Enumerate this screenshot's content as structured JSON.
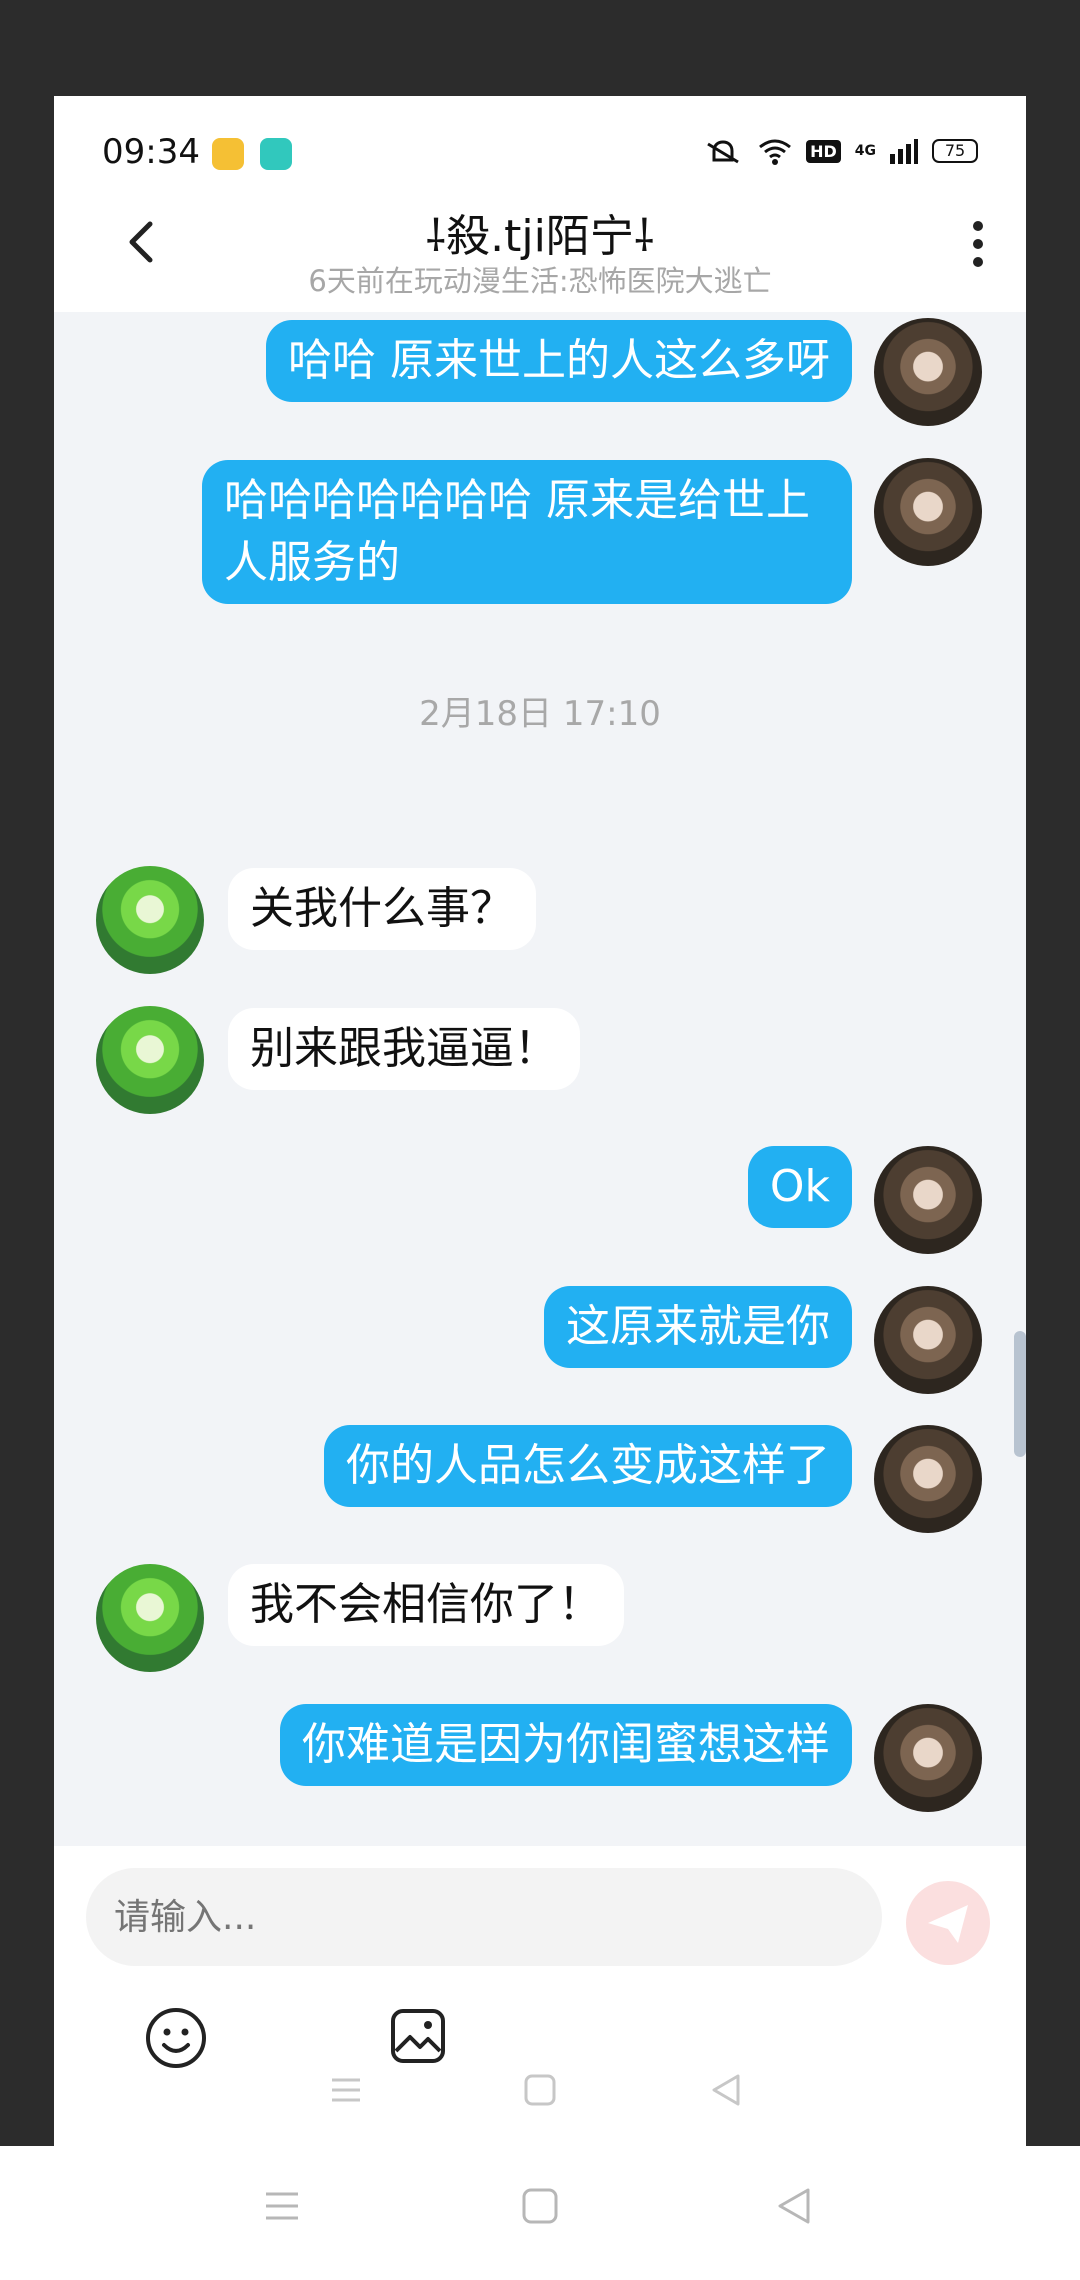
{
  "status": {
    "time": "09:34",
    "hd": "HD",
    "network": "4G",
    "battery": "75"
  },
  "header": {
    "title": "⸸殺.tji陌宁⸸",
    "subtitle": "6天前在玩动漫生活:恐怖医院大逃亡"
  },
  "messages": [
    {
      "dir": "out",
      "text": "哈哈 原来世上的人这么多呀"
    },
    {
      "dir": "out",
      "text": "哈哈哈哈哈哈哈 原来是给世上人服务的"
    },
    {
      "dir": "in",
      "text": "关我什么事？"
    },
    {
      "dir": "in",
      "text": "别来跟我逼逼！"
    },
    {
      "dir": "out",
      "text": "Ok"
    },
    {
      "dir": "out",
      "text": "这原来就是你"
    },
    {
      "dir": "out",
      "text": "你的人品怎么变成这样了"
    },
    {
      "dir": "in",
      "text": "我不会相信你了！"
    },
    {
      "dir": "out",
      "text": "你难道是因为你闺蜜想这样"
    }
  ],
  "timestamp": "2月18日 17:10",
  "input": {
    "placeholder": "请输入..."
  },
  "colors": {
    "outgoing_bubble": "#22b0f2",
    "incoming_bubble": "#ffffff",
    "send_button": "#fbdfdf"
  },
  "icons": [
    "back-icon",
    "more-icon",
    "emoji-icon",
    "image-icon",
    "send-icon"
  ]
}
